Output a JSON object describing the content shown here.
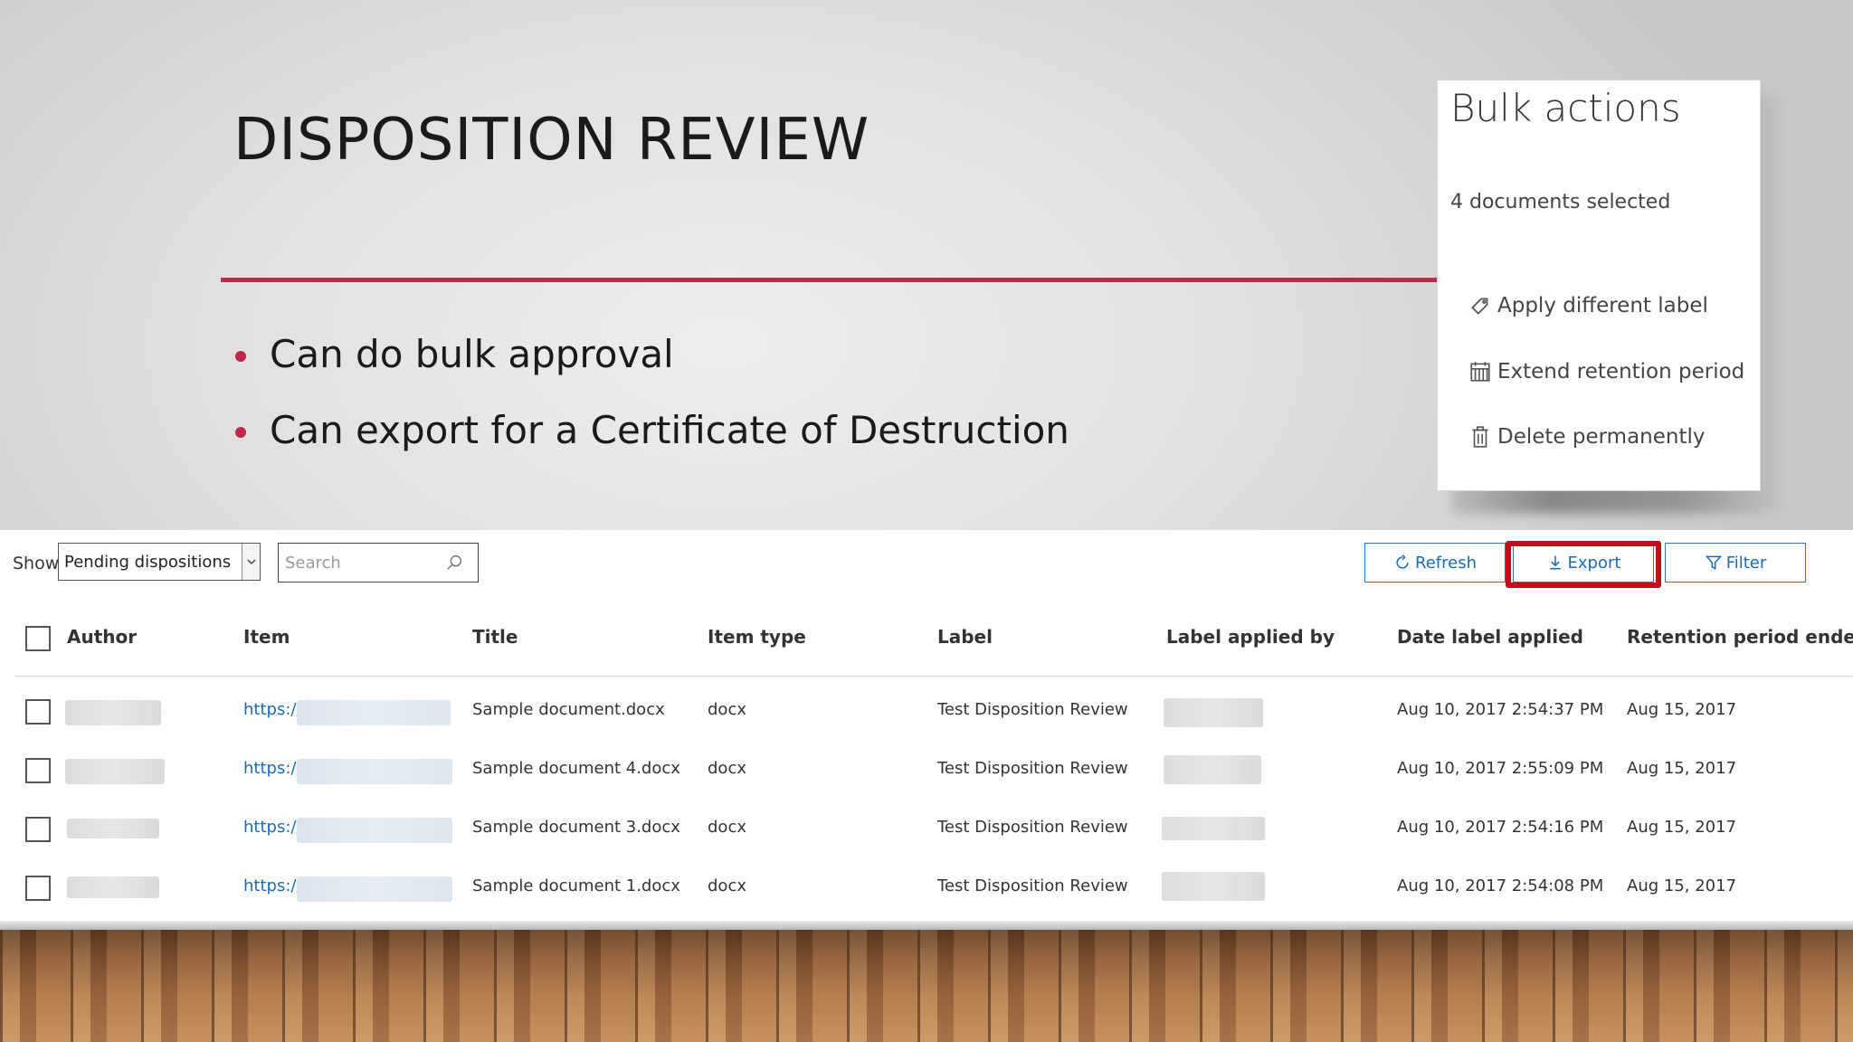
{
  "slide": {
    "title": "DISPOSITION REVIEW",
    "bullets": [
      "Can do bulk approval",
      "Can export for a Certificate of Destruction"
    ],
    "accent_color": "#c0284a"
  },
  "bulk_actions": {
    "title": "Bulk actions",
    "selected_text": "4 documents selected",
    "actions": [
      {
        "label": "Apply different label",
        "icon": "tag-icon"
      },
      {
        "label": "Extend retention period",
        "icon": "calendar-icon"
      },
      {
        "label": "Delete permanently",
        "icon": "trash-icon"
      }
    ]
  },
  "toolbar": {
    "show_label": "Show",
    "show_value": "Pending dispositions",
    "search_placeholder": "Search",
    "refresh_label": "Refresh",
    "export_label": "Export",
    "filter_label": "Filter",
    "export_highlight_color": "#c00f1c",
    "button_color": "#1a6bb5"
  },
  "table": {
    "columns": [
      "Author",
      "Item",
      "Title",
      "Item type",
      "Label",
      "Label applied by",
      "Date label applied",
      "Retention period ended"
    ],
    "rows": [
      {
        "item": "https://",
        "title": "Sample document.docx",
        "item_type": "docx",
        "label": "Test Disposition Review",
        "date_applied": "Aug 10, 2017 2:54:37 PM",
        "retention_ended": "Aug 15, 2017"
      },
      {
        "item": "https://",
        "title": "Sample document 4.docx",
        "item_type": "docx",
        "label": "Test Disposition Review",
        "date_applied": "Aug 10, 2017 2:55:09 PM",
        "retention_ended": "Aug 15, 2017"
      },
      {
        "item": "https://",
        "title": "Sample document 3.docx",
        "item_type": "docx",
        "label": "Test Disposition Review",
        "date_applied": "Aug 10, 2017 2:54:16 PM",
        "retention_ended": "Aug 15, 2017"
      },
      {
        "item": "https://",
        "title": "Sample document 1.docx",
        "item_type": "docx",
        "label": "Test Disposition Review",
        "date_applied": "Aug 10, 2017 2:54:08 PM",
        "retention_ended": "Aug 15, 2017"
      }
    ]
  }
}
